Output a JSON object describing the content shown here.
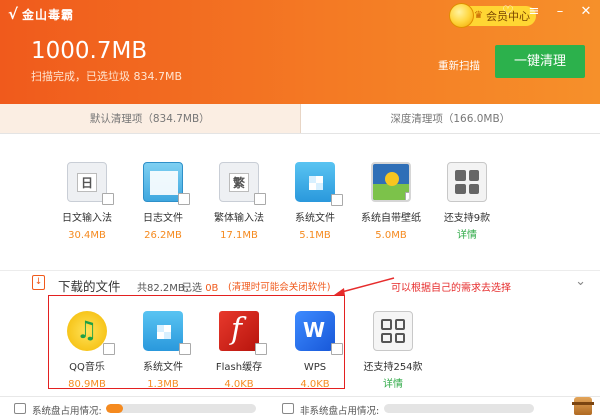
{
  "header": {
    "logo_icon": "√",
    "logo_text": "金山毒霸",
    "vip_label": "会员中心",
    "vip_crown": "♛",
    "window_controls": {
      "skin": "♡",
      "menu": "≡",
      "minimize": "–",
      "close": "✕"
    },
    "scan_size": "1000.7MB",
    "scan_status": "扫描完成，已选垃圾 834.7MB",
    "rescan_label": "重新扫描",
    "clean_label": "一键清理"
  },
  "tabs": [
    {
      "label": "默认清理项（834.7MB）",
      "active": true
    },
    {
      "label": "深度清理项（166.0MB）",
      "active": false
    }
  ],
  "common_files": {
    "items": [
      {
        "name": "日文输入法",
        "size": "30.4MB",
        "icon": "ime-doc-icon",
        "glyph": "日"
      },
      {
        "name": "日志文件",
        "size": "26.2MB",
        "icon": "log-file-icon"
      },
      {
        "name": "繁体输入法",
        "size": "17.1MB",
        "icon": "ime-doc-icon",
        "glyph": "繁"
      },
      {
        "name": "系统文件",
        "size": "5.1MB",
        "icon": "windows-folder-icon"
      },
      {
        "name": "系统自带壁纸",
        "size": "5.0MB",
        "icon": "wallpaper-icon"
      },
      {
        "name": "还支持9款",
        "size": "详情",
        "icon": "more-apps-icon",
        "more": true
      }
    ]
  },
  "downloads": {
    "title": "下载的文件",
    "stat": "共82.2MB，",
    "selected_label": "已选",
    "selected_value": "0B",
    "note": "(清理时可能会关闭软件)",
    "collapse_icon": "⌄",
    "items": [
      {
        "name": "QQ音乐",
        "size": "80.9MB",
        "icon": "qq-music-icon"
      },
      {
        "name": "系统文件",
        "size": "1.3MB",
        "icon": "windows-folder-icon"
      },
      {
        "name": "Flash缓存",
        "size": "4.0KB",
        "icon": "flash-icon"
      },
      {
        "name": "WPS",
        "size": "4.0KB",
        "icon": "wps-icon"
      },
      {
        "name": "还支持254款",
        "size": "详情",
        "icon": "more-apps-icon",
        "more": true
      }
    ]
  },
  "annotation": {
    "text": "可以根据自己的需求去选择",
    "color": "#e62c2c"
  },
  "footer": {
    "system_disk_label": "系统盘占用情况:",
    "system_disk_usage": 0.11,
    "other_disk_label": "非系统盘占用情况:",
    "other_disk_usage": 0.0
  },
  "colors": {
    "header_orange": "#f05a1c",
    "clean_green": "#2cb14c",
    "size_orange": "#f58a1f",
    "details_green": "#2faa47"
  }
}
